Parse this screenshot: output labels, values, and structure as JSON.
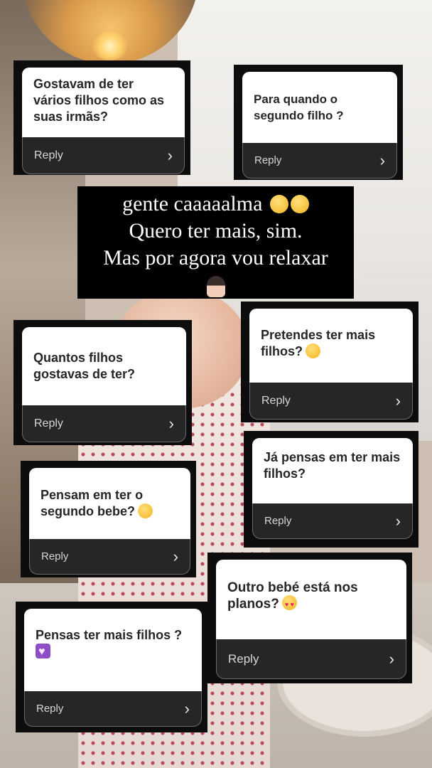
{
  "overlay": {
    "line1": "gente caaaaalma",
    "line2": "Quero ter mais, sim.",
    "line3": "Mas por agora vou relaxar",
    "emoji_line1": "rolling-on-floor-laughing x2",
    "emoji_line4": "woman-gesturing-face"
  },
  "reply_label": "Reply",
  "cards": [
    {
      "question": "Gostavam de ter vários filhos como as suas irmãs?",
      "reply": "Reply"
    },
    {
      "question": "Para quando o segundo filho ?",
      "reply": "Reply"
    },
    {
      "question": "Quantos filhos gostavas de ter?",
      "reply": "Reply"
    },
    {
      "question": "Pretendes ter mais filhos?",
      "emoji": "hugging-face",
      "reply": "Reply"
    },
    {
      "question": "Já pensas em ter mais filhos?",
      "reply": "Reply"
    },
    {
      "question": "Pensam em ter o segundo bebe?",
      "emoji": "smiling-face",
      "reply": "Reply"
    },
    {
      "question": "Outro bebé está nos planos?",
      "emoji": "heart-eyes-face",
      "reply": "Reply"
    },
    {
      "question": "Pensas ter mais filhos ?",
      "emoji": "purple-heart",
      "reply": "Reply"
    }
  ]
}
